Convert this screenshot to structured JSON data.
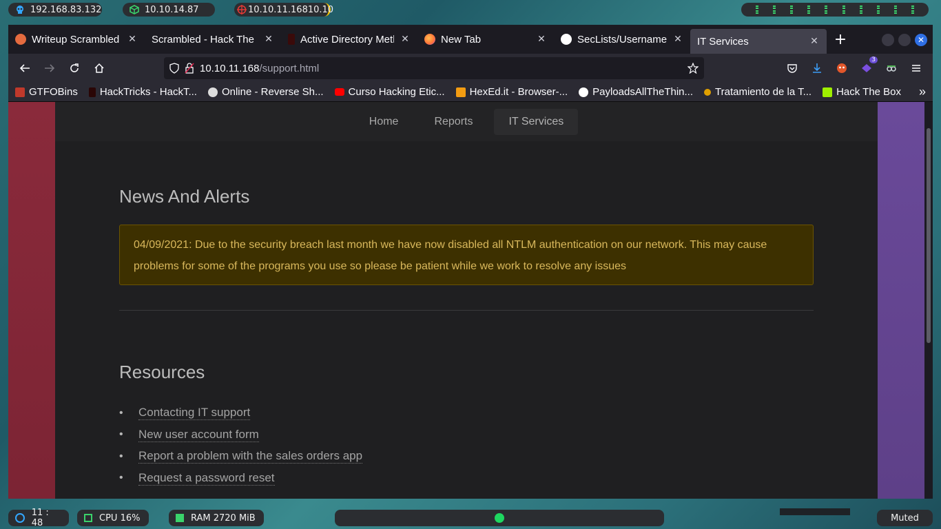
{
  "topbar": {
    "local_ip": "192.168.83.132",
    "vpn_ip": "10.10.14.87",
    "target_ip": "10.10.11.16810.10"
  },
  "browser": {
    "tabs": [
      {
        "title": "Writeup Scrambled H",
        "favicon_color": "#e46b3f"
      },
      {
        "title": "Scrambled - Hack The Bo",
        "favicon_color": ""
      },
      {
        "title": "Active Directory Meth",
        "favicon_color": "#c01818"
      },
      {
        "title": "New Tab",
        "favicon_color": "#ff7139"
      },
      {
        "title": "SecLists/Usernames a",
        "favicon_color": "#ffffff"
      },
      {
        "title": "IT Services",
        "favicon_color": ""
      }
    ],
    "active_tab_index": 5,
    "url_host": "10.10.11.168",
    "url_path": "/support.html",
    "extension_badge": "3",
    "bookmarks": [
      {
        "label": "GTFOBins",
        "color": "#c0392b"
      },
      {
        "label": "HackTricks - HackT...",
        "color": "#b22222"
      },
      {
        "label": "Online - Reverse Sh...",
        "color": "#dddddd"
      },
      {
        "label": "Curso Hacking Etic...",
        "color": "#ff0000"
      },
      {
        "label": "HexEd.it - Browser-...",
        "color": "#f39c12"
      },
      {
        "label": "PayloadsAllTheThin...",
        "color": "#ffffff"
      },
      {
        "label": "Tratamiento de la T...",
        "color": "#e0a000"
      },
      {
        "label": "Hack The Box",
        "color": "#9fef00"
      }
    ]
  },
  "site": {
    "nav": [
      "Home",
      "Reports",
      "IT Services"
    ],
    "news_title": "News And Alerts",
    "alert_text": "04/09/2021: Due to the security breach last month we have now disabled all NTLM authentication on our network. This may cause problems for some of the programs you use so please be patient while we work to resolve any issues",
    "resources_title": "Resources",
    "resources": [
      "Contacting IT support",
      "New user account form",
      "Report a problem with the sales orders app",
      "Request a password reset"
    ]
  },
  "bottombar": {
    "clock": "11 : 48",
    "cpu": "CPU 16%",
    "ram": "RAM 2720 MiB",
    "volume": "Muted"
  },
  "colors": {
    "alert_bg": "#3d3000",
    "alert_text": "#d9b85c",
    "accent_blue": "#2f6fe4"
  }
}
